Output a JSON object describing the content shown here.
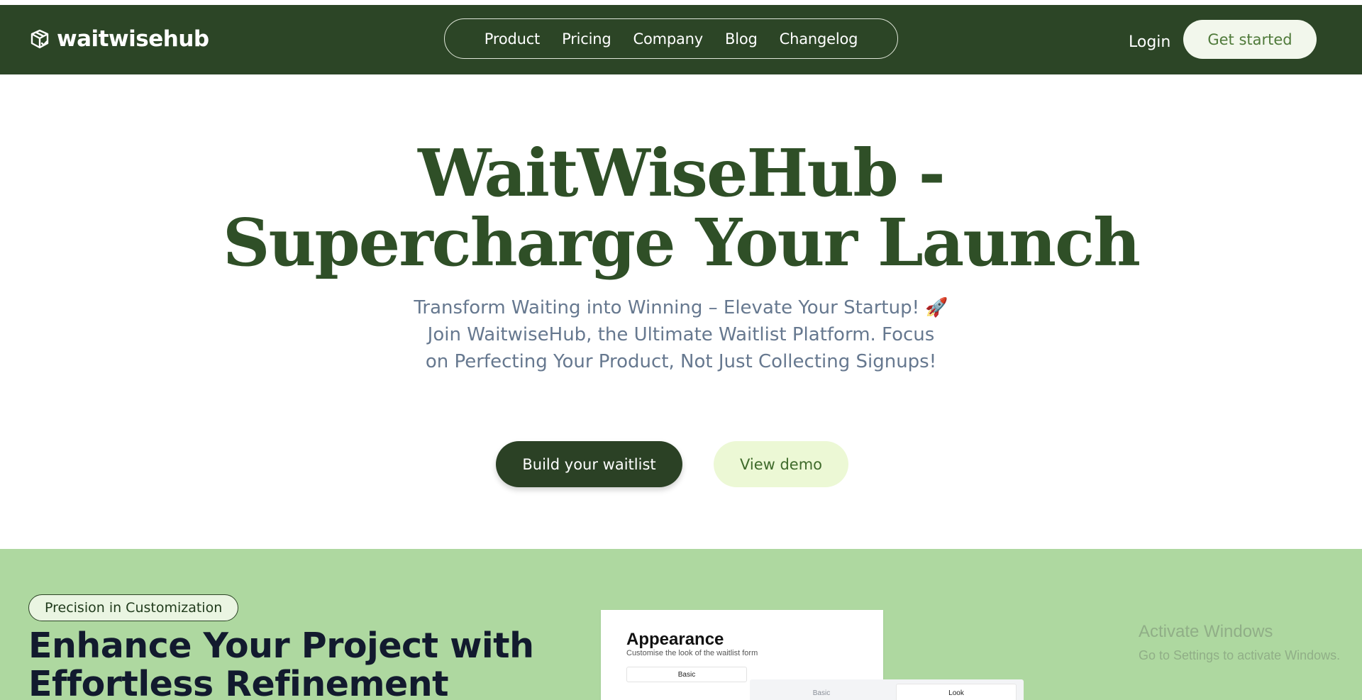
{
  "nav": {
    "brand": "waitwisehub",
    "items": [
      {
        "label": "Product"
      },
      {
        "label": "Pricing"
      },
      {
        "label": "Company"
      },
      {
        "label": "Blog"
      },
      {
        "label": "Changelog"
      }
    ],
    "login": "Login",
    "cta": "Get started"
  },
  "hero": {
    "title_line1": "WaitWiseHub -",
    "title_line2": "Supercharge Your Launch",
    "sub_line1": "Transform Waiting into Winning – Elevate Your Startup! 🚀",
    "sub_line2": "Join WaitwiseHub, the Ultimate Waitlist Platform. Focus",
    "sub_line3": "on Perfecting Your Product, Not Just Collecting Signups!",
    "primary_button": "Build your waitlist",
    "secondary_button": "View demo"
  },
  "feature": {
    "badge": "Precision in Customization",
    "title_line1": "Enhance Your Project with",
    "title_line2": "Effortless Refinement",
    "card": {
      "title": "Appearance",
      "subtitle": "Customise the look of the waitlist form",
      "tab_basic": "Basic"
    },
    "card2": {
      "tab_basic": "Basic",
      "tab_look": "Look"
    }
  },
  "watermark": {
    "title": "Activate Windows",
    "subtitle": "Go to Settings to activate Windows."
  },
  "colors": {
    "nav_bg": "#2c4526",
    "hero_title": "#2f4f27",
    "feature_bg": "#aed8a0",
    "secondary_btn_bg": "#ecf8d5"
  }
}
